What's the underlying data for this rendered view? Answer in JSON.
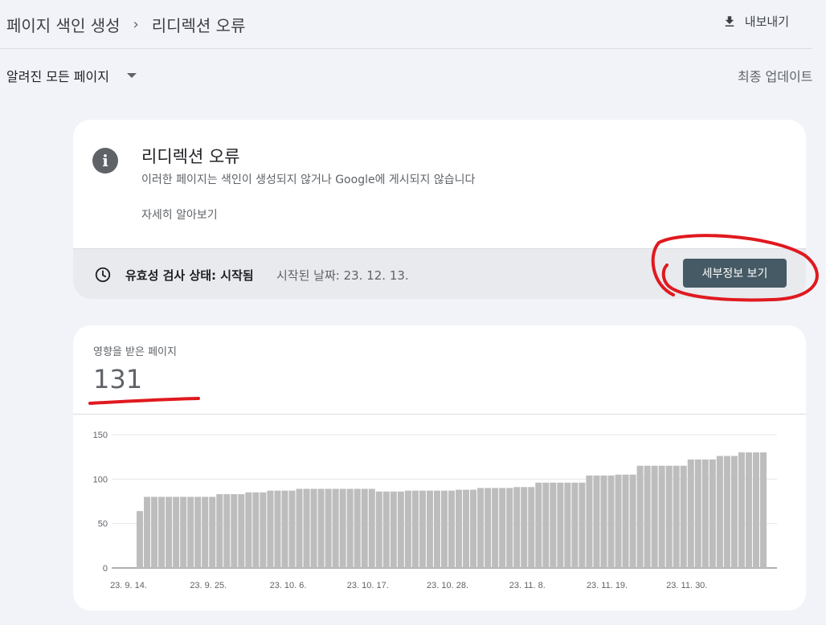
{
  "header": {
    "breadcrumb_root": "페이지 색인 생성",
    "breadcrumb_current": "리디렉션 오류",
    "export_label": "내보내기"
  },
  "filter": {
    "selected": "알려진 모든 페이지",
    "last_update": "최종 업데이트"
  },
  "issue_card": {
    "title": "리디렉션 오류",
    "description": "이러한 페이지는 색인이 생성되지 않거나 Google에 게시되지 않습니다",
    "learn_more": "자세히 알아보기",
    "validation_label": "유효성 검사 상태: 시작됨",
    "validation_started": "시작된 날짜: 23. 12. 13.",
    "details_button": "세부정보 보기"
  },
  "affected_card": {
    "label": "영향을 받은 페이지",
    "value": "131"
  },
  "annotation_color": "#e0191f",
  "chart_data": {
    "type": "bar",
    "title": "",
    "xlabel": "",
    "ylabel": "",
    "ylim": [
      0,
      150
    ],
    "yticks": [
      0,
      50,
      100,
      150
    ],
    "grid": true,
    "color": "#bdbdbd",
    "x_tick_labels": [
      "23. 9. 14.",
      "23. 9. 25.",
      "23. 10. 6.",
      "23. 10. 17.",
      "23. 10. 28.",
      "23. 11. 8.",
      "23. 11. 19.",
      "23. 11. 30."
    ],
    "x_tick_index": [
      0,
      11,
      22,
      33,
      44,
      55,
      66,
      77
    ],
    "categories": [
      "23. 9. 14.",
      "23. 9. 15.",
      "23. 9. 16.",
      "23. 9. 17.",
      "23. 9. 18.",
      "23. 9. 19.",
      "23. 9. 20.",
      "23. 9. 21.",
      "23. 9. 22.",
      "23. 9. 23.",
      "23. 9. 24.",
      "23. 9. 25.",
      "23. 9. 26.",
      "23. 9. 27.",
      "23. 9. 28.",
      "23. 9. 29.",
      "23. 9. 30.",
      "23. 10. 1.",
      "23. 10. 2.",
      "23. 10. 3.",
      "23. 10. 4.",
      "23. 10. 5.",
      "23. 10. 6.",
      "23. 10. 7.",
      "23. 10. 8.",
      "23. 10. 9.",
      "23. 10. 10.",
      "23. 10. 11.",
      "23. 10. 12.",
      "23. 10. 13.",
      "23. 10. 14.",
      "23. 10. 15.",
      "23. 10. 16.",
      "23. 10. 17.",
      "23. 10. 18.",
      "23. 10. 19.",
      "23. 10. 20.",
      "23. 10. 21.",
      "23. 10. 22.",
      "23. 10. 23.",
      "23. 10. 24.",
      "23. 10. 25.",
      "23. 10. 26.",
      "23. 10. 27.",
      "23. 10. 28.",
      "23. 10. 29.",
      "23. 10. 30.",
      "23. 10. 31.",
      "23. 11. 1.",
      "23. 11. 2.",
      "23. 11. 3.",
      "23. 11. 4.",
      "23. 11. 5.",
      "23. 11. 6.",
      "23. 11. 7.",
      "23. 11. 8.",
      "23. 11. 9.",
      "23. 11. 10.",
      "23. 11. 11.",
      "23. 11. 12.",
      "23. 11. 13.",
      "23. 11. 14.",
      "23. 11. 15.",
      "23. 11. 16.",
      "23. 11. 17.",
      "23. 11. 18.",
      "23. 11. 19.",
      "23. 11. 20.",
      "23. 11. 21.",
      "23. 11. 22.",
      "23. 11. 23.",
      "23. 11. 24.",
      "23. 11. 25.",
      "23. 11. 26.",
      "23. 11. 27.",
      "23. 11. 28.",
      "23. 11. 29.",
      "23. 11. 30.",
      "23. 12. 1.",
      "23. 12. 2.",
      "23. 12. 3.",
      "23. 12. 4.",
      "23. 12. 5.",
      "23. 12. 6.",
      "23. 12. 7.",
      "23. 12. 8.",
      "23. 12. 9."
    ],
    "values": [
      64,
      80,
      80,
      80,
      80,
      80,
      80,
      80,
      80,
      80,
      80,
      83,
      83,
      83,
      83,
      85,
      85,
      85,
      87,
      87,
      87,
      87,
      89,
      89,
      89,
      89,
      89,
      89,
      89,
      89,
      89,
      89,
      89,
      86,
      86,
      86,
      86,
      87,
      87,
      87,
      87,
      87,
      87,
      87,
      88,
      88,
      88,
      90,
      90,
      90,
      90,
      90,
      91,
      91,
      91,
      96,
      96,
      96,
      96,
      96,
      96,
      96,
      104,
      104,
      104,
      104,
      105,
      105,
      105,
      115,
      115,
      115,
      115,
      115,
      115,
      115,
      122,
      122,
      122,
      122,
      126,
      126,
      126,
      130,
      130,
      130,
      130
    ]
  }
}
